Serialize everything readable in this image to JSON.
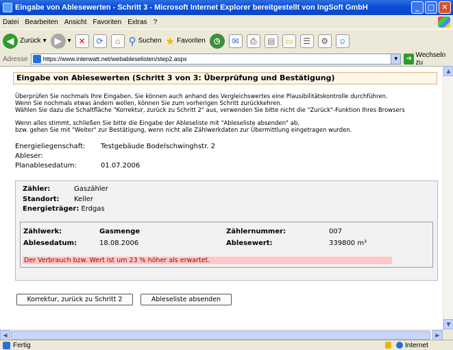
{
  "window": {
    "title": "Eingabe von Ablesewerten - Schritt 3 - Microsoft Internet Explorer bereitgestellt von IngSoft GmbH"
  },
  "menu": [
    "Datei",
    "Bearbeiten",
    "Ansicht",
    "Favoriten",
    "Extras",
    "?"
  ],
  "toolbar": {
    "back_label": "Zurück",
    "search_label": "Suchen",
    "favorites_label": "Favoriten"
  },
  "address": {
    "label": "Adresse",
    "url": "https://www.interwatt.net/webableselisten/step2.aspx",
    "go_label": "Wechseln zu"
  },
  "page": {
    "header": "Eingabe von Ablesewerten (Schritt 3 von 3: Überprüfung und Bestätigung)",
    "para1": [
      "Überprüfen Sie nochmals Ihre Eingaben. Sie können auch anhand des Vergleichswertes eine Plausibilitätskontrolle durchführen.",
      "Wenn Sie nochmals etwas ändern wollen, können Sie zum vorherigen Schritt zurückkehren.",
      "Wählen Sie dazu die Schaltfläche \"Korrektur, zurück zu Schritt 2\" aus, verwenden Sie bitte nicht die \"Zurück\"-Funktion Ihres Browsers"
    ],
    "para2": [
      "Wenn alles stimmt, schließen Sie bitte die Eingabe der Ableseliste mit \"Ableseliste absenden\" ab,",
      "bzw. gehen Sie mit \"Weiter\" zur Bestätigung, wenn nicht alle Zählwerkdaten zur Übermittlung eingetragen wurden."
    ],
    "info": {
      "property_label": "Energieliegenschaft:",
      "property_value": "Testgebäude Bodelschwinghstr. 2",
      "reader_label": "Ableser:",
      "reader_value": "",
      "date_label": "Planablesedatum:",
      "date_value": "01.07.2006"
    },
    "meter": {
      "meter_label": "Zähler:",
      "meter_value": "Gaszähler",
      "location_label": "Standort:",
      "location_value": "Keller",
      "carrier_label": "Energieträger:",
      "carrier_value": "Erdgas"
    },
    "reading": {
      "register_label": "Zählwerk:",
      "register_value": "Gasmenge",
      "number_label": "Zählernummer:",
      "number_value": "007",
      "date_label": "Ablesedatum:",
      "date_value": "18.08.2006",
      "value_label": "Ablesewert:",
      "value_value": "339800 m³"
    },
    "warning": "Der Verbrauch bzw. Wert ist um 23 % höher als erwartet.",
    "buttons": {
      "correction": "Korrektur, zurück zu Schritt 2",
      "submit": "Ableseliste absenden"
    }
  },
  "status": {
    "text": "Fertig",
    "zone": "Internet"
  }
}
